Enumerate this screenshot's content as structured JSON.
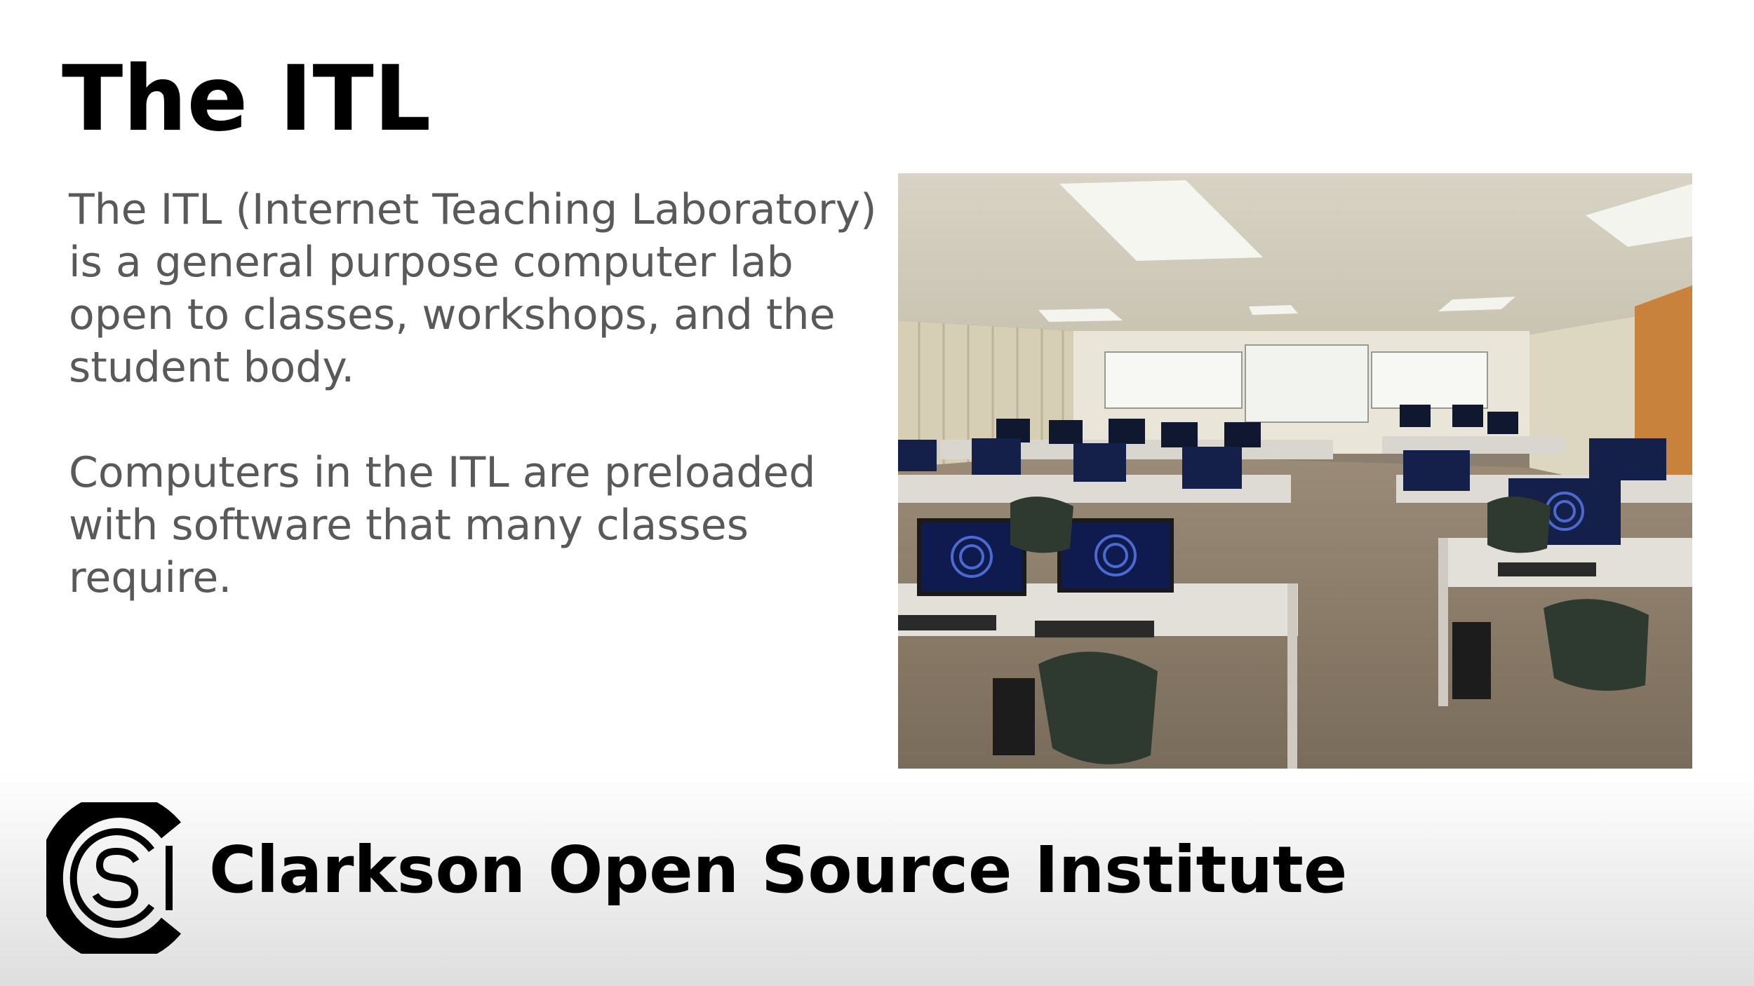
{
  "slide": {
    "title": "The ITL",
    "paragraphs": [
      "The ITL (Internet Teaching Laboratory) is a general purpose computer lab open to classes, workshops, and the student body.",
      "Computers in the ITL are preloaded with software that many classes require."
    ]
  },
  "photo": {
    "subject": "computer-lab-classroom"
  },
  "footer": {
    "logo_letters": "COSI",
    "organization": "Clarkson Open Source Institute"
  },
  "colors": {
    "title": "#000000",
    "body_text": "#595959",
    "footer_gradient_top": "#ffffff",
    "footer_gradient_bottom": "#dedede",
    "monitor_screen": "#1a2a6a"
  }
}
